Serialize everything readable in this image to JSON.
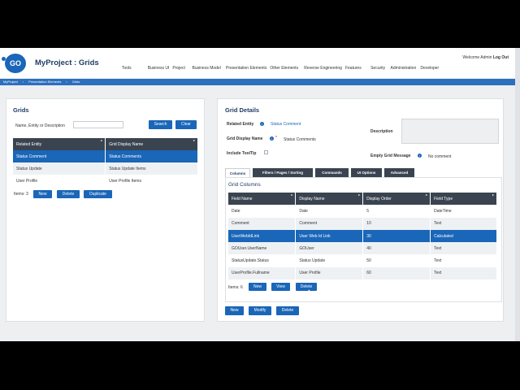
{
  "app": {
    "title": "MyProject : Grids",
    "logo_text": "GO"
  },
  "user": {
    "welcome": "Welcome Admin",
    "logout": "Log Out"
  },
  "menu": [
    "Tools",
    "Business UI",
    "Project",
    "Business Model",
    "Presentation Elements",
    "Other Elements",
    "Reverse Engineering",
    "Features",
    "Security",
    "Administration",
    "Developer"
  ],
  "breadcrumb": [
    "MyProject",
    "Presentation Elements",
    "Grids"
  ],
  "grids_panel": {
    "title": "Grids",
    "search_label": "Name, Entity or Description",
    "search_value": "",
    "search_button": "Search",
    "clear_button": "Clear",
    "columns": [
      "Related Entity",
      "Grid Display Name"
    ],
    "rows": [
      [
        "Status Comment",
        "Status Comments"
      ],
      [
        "Status Update",
        "Status Update Items"
      ],
      [
        "User Profile",
        "User Profile Items"
      ]
    ],
    "items_label": "Items: 3",
    "new_button": "New",
    "delete_button": "Delete",
    "duplicate_button": "Duplicate"
  },
  "details_panel": {
    "title": "Grid Details",
    "related_entity_label": "Related Entity",
    "related_entity_value": "Status Comment",
    "display_name_label": "Grid Display Name",
    "display_name_required": "*",
    "display_name_value": "Status Comments",
    "include_tooltip_label": "Include ToolTip",
    "description_label": "Description",
    "description_value": "",
    "empty_msg_label": "Empty Grid Message",
    "empty_msg_value": "No comment",
    "tabs": [
      "Columns",
      "Filters / Pages / Sorting",
      "Commands",
      "UI Options",
      "Advanced"
    ],
    "grid_columns_title": "Grid Columns",
    "columns": [
      "Field Name",
      "Display Name",
      "Display Order",
      "Field Type"
    ],
    "rows": [
      [
        "Date",
        "Date",
        "5",
        "DateTime"
      ],
      [
        "Comment",
        "Comment",
        "10",
        "Text"
      ],
      [
        "UserWebIdLink",
        "User Web Id Link",
        "30",
        "Calculated"
      ],
      [
        "GOUser.UserName",
        "GOUser",
        "40",
        "Text"
      ],
      [
        "StatusUpdate.Status",
        "Status Update",
        "50",
        "Text"
      ],
      [
        "UserProfile.Fullname",
        "User Profile",
        "60",
        "Text"
      ]
    ],
    "items_label": "Items: 6",
    "new_button": "New",
    "view_button": "View",
    "delete_button": "Delete",
    "footer_new": "New",
    "footer_modify": "Modify",
    "footer_delete": "Delete"
  },
  "colors": {
    "accent": "#1a66b8",
    "header_dark": "#3a4450",
    "title": "#1f3b63"
  }
}
